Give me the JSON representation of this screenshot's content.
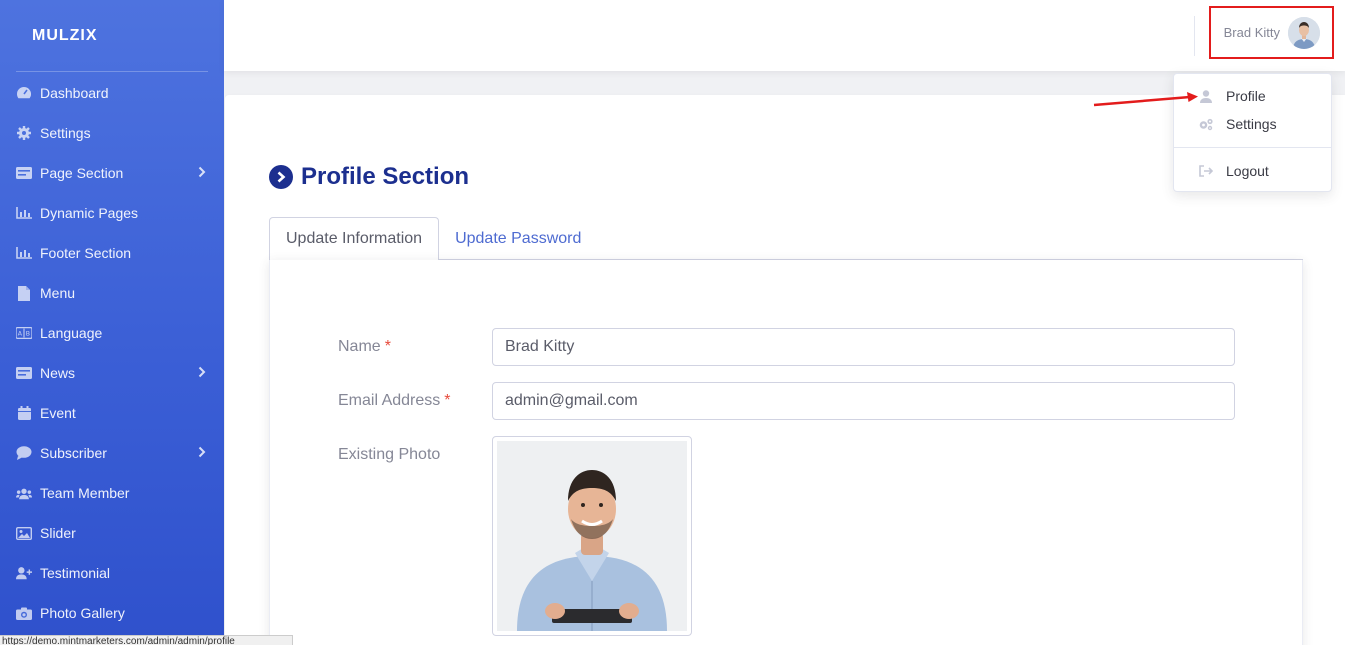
{
  "brand": "MULZIX",
  "sidebar": {
    "items": [
      {
        "label": "Dashboard",
        "icon": "dashboard-icon"
      },
      {
        "label": "Settings",
        "icon": "gear-icon"
      },
      {
        "label": "Page Section",
        "icon": "card-icon",
        "has_children": true
      },
      {
        "label": "Dynamic Pages",
        "icon": "chart-icon"
      },
      {
        "label": "Footer Section",
        "icon": "chart-icon"
      },
      {
        "label": "Menu",
        "icon": "file-icon"
      },
      {
        "label": "Language",
        "icon": "language-icon"
      },
      {
        "label": "News",
        "icon": "card-icon",
        "has_children": true
      },
      {
        "label": "Event",
        "icon": "calendar-icon"
      },
      {
        "label": "Subscriber",
        "icon": "comment-icon",
        "has_children": true
      },
      {
        "label": "Team Member",
        "icon": "users-icon"
      },
      {
        "label": "Slider",
        "icon": "image-icon"
      },
      {
        "label": "Testimonial",
        "icon": "user-plus-icon"
      },
      {
        "label": "Photo Gallery",
        "icon": "camera-icon"
      }
    ]
  },
  "topbar": {
    "user_name": "Brad Kitty"
  },
  "dropdown": {
    "items": [
      {
        "label": "Profile",
        "icon": "user-icon"
      },
      {
        "label": "Settings",
        "icon": "cogs-icon"
      },
      {
        "label": "Logout",
        "icon": "sign-out-icon"
      }
    ]
  },
  "main": {
    "title": "Profile Section",
    "tabs": [
      {
        "label": "Update Information",
        "active": true
      },
      {
        "label": "Update Password",
        "active": false
      }
    ],
    "form": {
      "name_label": "Name",
      "name_value": "Brad Kitty",
      "email_label": "Email Address",
      "email_value": "admin@gmail.com",
      "photo_label": "Existing Photo",
      "required_mark": "*"
    }
  },
  "statusbar": {
    "url": "https://demo.mintmarketers.com/admin/admin/profile"
  },
  "colors": {
    "sidebar": "#4e73df",
    "title": "#1c2f8f",
    "highlight": "#e31c1c",
    "link": "#4e6bd1"
  }
}
